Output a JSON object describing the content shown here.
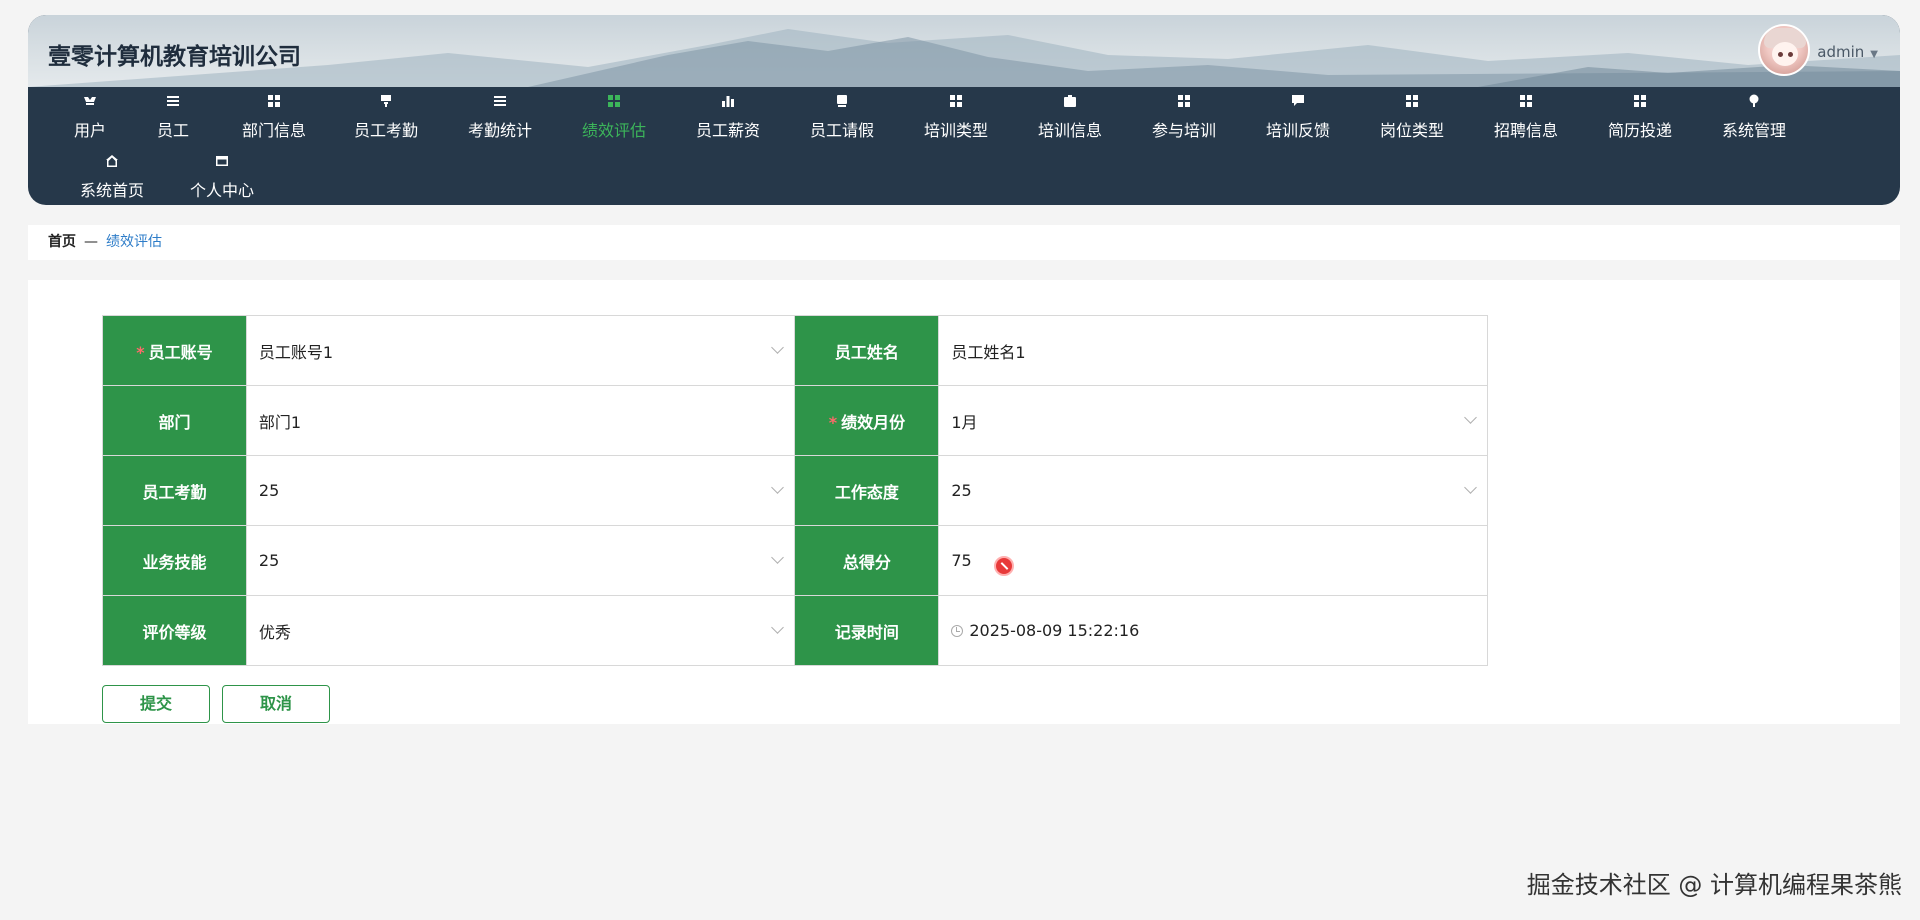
{
  "header": {
    "company_title": "壹零计算机教育培训公司",
    "user_name": "admin"
  },
  "nav": {
    "items": [
      {
        "label": "用户",
        "icon": "user-icon"
      },
      {
        "label": "员工",
        "icon": "list-icon"
      },
      {
        "label": "部门信息",
        "icon": "grid-icon"
      },
      {
        "label": "员工考勤",
        "icon": "attendance-icon"
      },
      {
        "label": "考勤统计",
        "icon": "list-icon"
      },
      {
        "label": "绩效评估",
        "icon": "grid-icon",
        "active": true
      },
      {
        "label": "员工薪资",
        "icon": "bar-chart-icon"
      },
      {
        "label": "员工请假",
        "icon": "document-icon"
      },
      {
        "label": "培训类型",
        "icon": "grid-icon"
      },
      {
        "label": "培训信息",
        "icon": "briefcase-icon"
      },
      {
        "label": "参与培训",
        "icon": "grid-icon"
      },
      {
        "label": "培训反馈",
        "icon": "chat-icon"
      },
      {
        "label": "岗位类型",
        "icon": "grid-icon"
      },
      {
        "label": "招聘信息",
        "icon": "grid-icon"
      },
      {
        "label": "简历投递",
        "icon": "grid-icon"
      },
      {
        "label": "系统管理",
        "icon": "location-icon"
      },
      {
        "label": "系统首页",
        "icon": "home-icon"
      },
      {
        "label": "个人中心",
        "icon": "card-icon"
      }
    ]
  },
  "breadcrumb": {
    "home": "首页",
    "separator": "—",
    "current": "绩效评估"
  },
  "form": {
    "employee_account_label": "员工账号",
    "employee_account_value": "员工账号1",
    "employee_name_label": "员工姓名",
    "employee_name_value": "员工姓名1",
    "department_label": "部门",
    "department_value": "部门1",
    "month_label": "绩效月份",
    "month_value": "1月",
    "attendance_label": "员工考勤",
    "attendance_value": "25",
    "attitude_label": "工作态度",
    "attitude_value": "25",
    "skill_label": "业务技能",
    "skill_value": "25",
    "total_label": "总得分",
    "total_value": "75",
    "grade_label": "评价等级",
    "grade_value": "优秀",
    "record_time_label": "记录时间",
    "record_time_value": "2025-08-09 15:22:16",
    "required_mark": "*"
  },
  "buttons": {
    "submit": "提交",
    "cancel": "取消"
  },
  "watermark": {
    "text": "掘金技术社区 @ 计算机编程果茶熊"
  },
  "colors": {
    "nav_bg": "#26384a",
    "active": "#3cb55a",
    "label_bg": "#2e9449",
    "breadcrumb_current": "#2d7cc8"
  }
}
